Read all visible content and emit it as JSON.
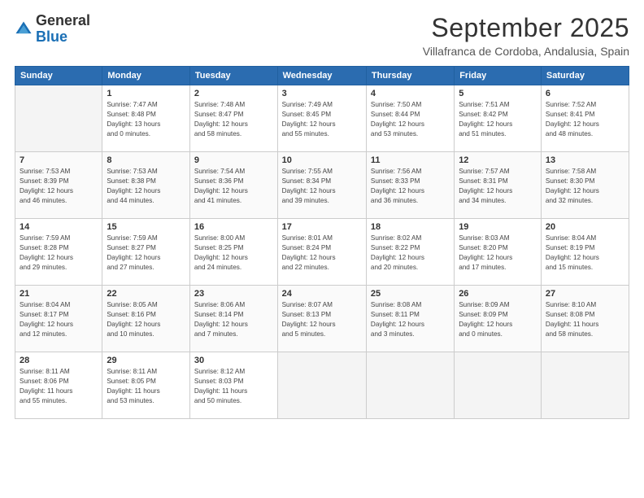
{
  "logo": {
    "general": "General",
    "blue": "Blue"
  },
  "header": {
    "month": "September 2025",
    "location": "Villafranca de Cordoba, Andalusia, Spain"
  },
  "days_of_week": [
    "Sunday",
    "Monday",
    "Tuesday",
    "Wednesday",
    "Thursday",
    "Friday",
    "Saturday"
  ],
  "weeks": [
    [
      {
        "day": "",
        "info": ""
      },
      {
        "day": "1",
        "info": "Sunrise: 7:47 AM\nSunset: 8:48 PM\nDaylight: 13 hours\nand 0 minutes."
      },
      {
        "day": "2",
        "info": "Sunrise: 7:48 AM\nSunset: 8:47 PM\nDaylight: 12 hours\nand 58 minutes."
      },
      {
        "day": "3",
        "info": "Sunrise: 7:49 AM\nSunset: 8:45 PM\nDaylight: 12 hours\nand 55 minutes."
      },
      {
        "day": "4",
        "info": "Sunrise: 7:50 AM\nSunset: 8:44 PM\nDaylight: 12 hours\nand 53 minutes."
      },
      {
        "day": "5",
        "info": "Sunrise: 7:51 AM\nSunset: 8:42 PM\nDaylight: 12 hours\nand 51 minutes."
      },
      {
        "day": "6",
        "info": "Sunrise: 7:52 AM\nSunset: 8:41 PM\nDaylight: 12 hours\nand 48 minutes."
      }
    ],
    [
      {
        "day": "7",
        "info": "Sunrise: 7:53 AM\nSunset: 8:39 PM\nDaylight: 12 hours\nand 46 minutes."
      },
      {
        "day": "8",
        "info": "Sunrise: 7:53 AM\nSunset: 8:38 PM\nDaylight: 12 hours\nand 44 minutes."
      },
      {
        "day": "9",
        "info": "Sunrise: 7:54 AM\nSunset: 8:36 PM\nDaylight: 12 hours\nand 41 minutes."
      },
      {
        "day": "10",
        "info": "Sunrise: 7:55 AM\nSunset: 8:34 PM\nDaylight: 12 hours\nand 39 minutes."
      },
      {
        "day": "11",
        "info": "Sunrise: 7:56 AM\nSunset: 8:33 PM\nDaylight: 12 hours\nand 36 minutes."
      },
      {
        "day": "12",
        "info": "Sunrise: 7:57 AM\nSunset: 8:31 PM\nDaylight: 12 hours\nand 34 minutes."
      },
      {
        "day": "13",
        "info": "Sunrise: 7:58 AM\nSunset: 8:30 PM\nDaylight: 12 hours\nand 32 minutes."
      }
    ],
    [
      {
        "day": "14",
        "info": "Sunrise: 7:59 AM\nSunset: 8:28 PM\nDaylight: 12 hours\nand 29 minutes."
      },
      {
        "day": "15",
        "info": "Sunrise: 7:59 AM\nSunset: 8:27 PM\nDaylight: 12 hours\nand 27 minutes."
      },
      {
        "day": "16",
        "info": "Sunrise: 8:00 AM\nSunset: 8:25 PM\nDaylight: 12 hours\nand 24 minutes."
      },
      {
        "day": "17",
        "info": "Sunrise: 8:01 AM\nSunset: 8:24 PM\nDaylight: 12 hours\nand 22 minutes."
      },
      {
        "day": "18",
        "info": "Sunrise: 8:02 AM\nSunset: 8:22 PM\nDaylight: 12 hours\nand 20 minutes."
      },
      {
        "day": "19",
        "info": "Sunrise: 8:03 AM\nSunset: 8:20 PM\nDaylight: 12 hours\nand 17 minutes."
      },
      {
        "day": "20",
        "info": "Sunrise: 8:04 AM\nSunset: 8:19 PM\nDaylight: 12 hours\nand 15 minutes."
      }
    ],
    [
      {
        "day": "21",
        "info": "Sunrise: 8:04 AM\nSunset: 8:17 PM\nDaylight: 12 hours\nand 12 minutes."
      },
      {
        "day": "22",
        "info": "Sunrise: 8:05 AM\nSunset: 8:16 PM\nDaylight: 12 hours\nand 10 minutes."
      },
      {
        "day": "23",
        "info": "Sunrise: 8:06 AM\nSunset: 8:14 PM\nDaylight: 12 hours\nand 7 minutes."
      },
      {
        "day": "24",
        "info": "Sunrise: 8:07 AM\nSunset: 8:13 PM\nDaylight: 12 hours\nand 5 minutes."
      },
      {
        "day": "25",
        "info": "Sunrise: 8:08 AM\nSunset: 8:11 PM\nDaylight: 12 hours\nand 3 minutes."
      },
      {
        "day": "26",
        "info": "Sunrise: 8:09 AM\nSunset: 8:09 PM\nDaylight: 12 hours\nand 0 minutes."
      },
      {
        "day": "27",
        "info": "Sunrise: 8:10 AM\nSunset: 8:08 PM\nDaylight: 11 hours\nand 58 minutes."
      }
    ],
    [
      {
        "day": "28",
        "info": "Sunrise: 8:11 AM\nSunset: 8:06 PM\nDaylight: 11 hours\nand 55 minutes."
      },
      {
        "day": "29",
        "info": "Sunrise: 8:11 AM\nSunset: 8:05 PM\nDaylight: 11 hours\nand 53 minutes."
      },
      {
        "day": "30",
        "info": "Sunrise: 8:12 AM\nSunset: 8:03 PM\nDaylight: 11 hours\nand 50 minutes."
      },
      {
        "day": "",
        "info": ""
      },
      {
        "day": "",
        "info": ""
      },
      {
        "day": "",
        "info": ""
      },
      {
        "day": "",
        "info": ""
      }
    ]
  ]
}
